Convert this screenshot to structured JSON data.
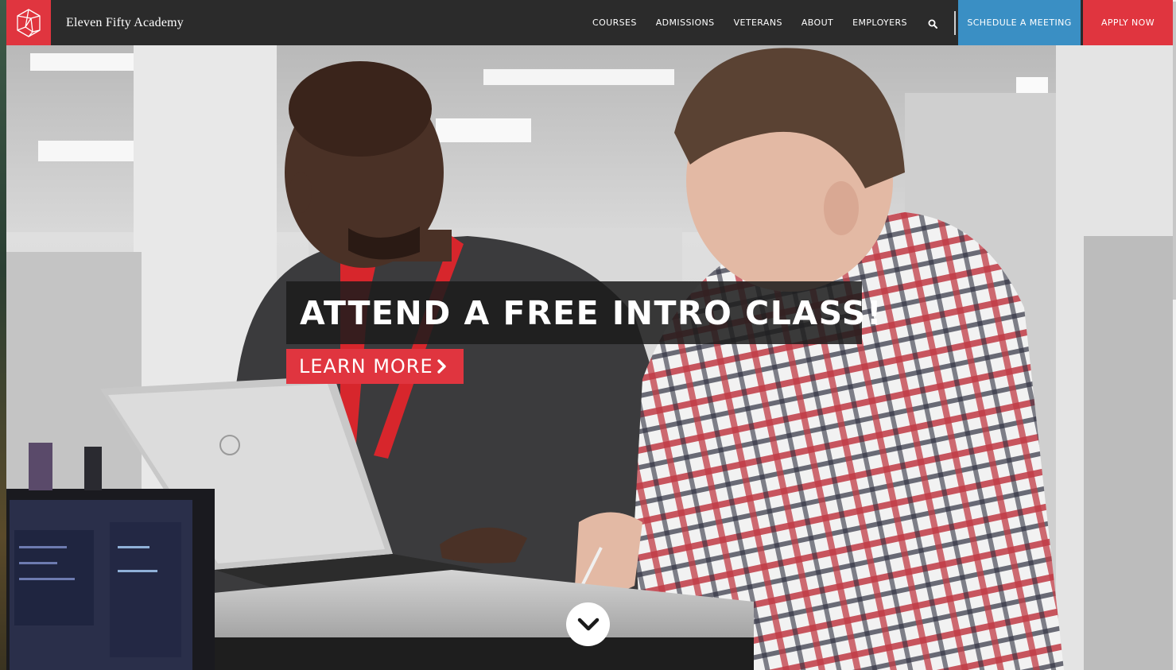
{
  "header": {
    "brand": "Eleven Fifty Academy",
    "nav": [
      {
        "label": "COURSES"
      },
      {
        "label": "ADMISSIONS"
      },
      {
        "label": "VETERANS"
      },
      {
        "label": "ABOUT"
      },
      {
        "label": "EMPLOYERS"
      }
    ],
    "schedule_label": "SCHEDULE A MEETING",
    "apply_label": "APPLY NOW"
  },
  "hero": {
    "headline": "ATTEND A FREE INTRO CLASS!",
    "cta_label": "LEARN MORE"
  },
  "icons": {
    "logo": "geometric-polygon-logo-icon",
    "search": "search-icon",
    "cta_arrow": "chevron-right-icon",
    "scroll": "chevron-down-icon"
  },
  "colors": {
    "header_bg": "#2b2b2b",
    "brand_red": "#e0353f",
    "schedule_blue": "#3a8fc4",
    "white": "#ffffff"
  }
}
